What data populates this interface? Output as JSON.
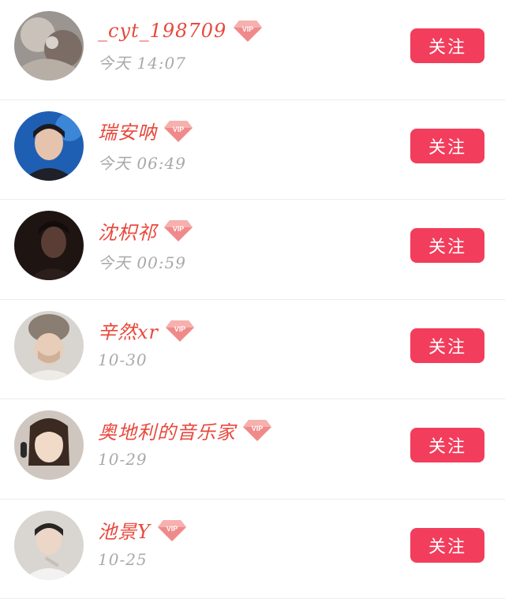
{
  "colors": {
    "name": "#e8483c",
    "time": "#a9a9a9",
    "follow_bg": "#f23d5c",
    "divider": "#ececec"
  },
  "follow_label": "关注",
  "vip_badge_label": "VIP",
  "users": [
    {
      "name": "_cyt_198709",
      "time": "今天 14:07",
      "avatar": "avatar-image"
    },
    {
      "name": "瑞安呐",
      "time": "今天 06:49",
      "avatar": "avatar-image"
    },
    {
      "name": "沈枳祁",
      "time": "今天 00:59",
      "avatar": "avatar-image"
    },
    {
      "name": "辛然xr",
      "time": "10-30",
      "avatar": "avatar-image"
    },
    {
      "name": "奥地利的音乐家",
      "time": "10-29",
      "avatar": "avatar-image"
    },
    {
      "name": "池景Y",
      "time": "10-25",
      "avatar": "avatar-image"
    }
  ]
}
